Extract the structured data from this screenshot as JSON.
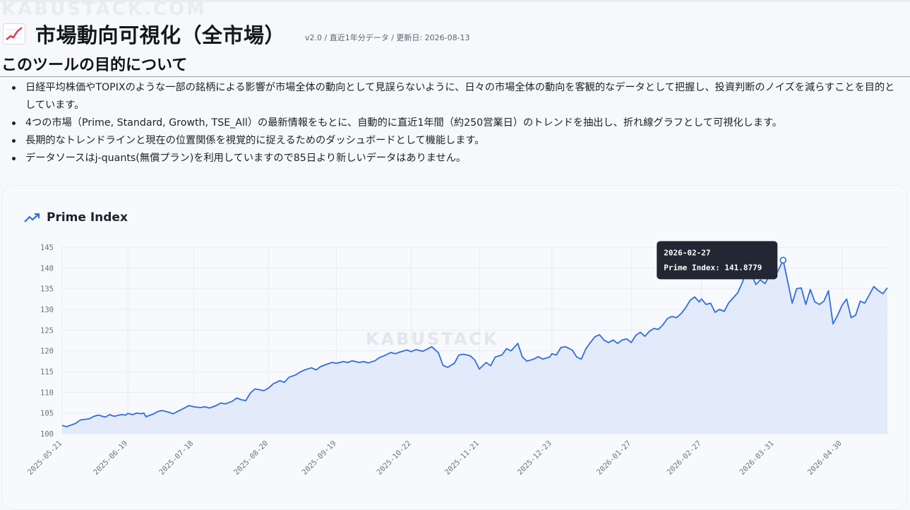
{
  "watermark": "KABUSTACK.COM",
  "header": {
    "icon": "chart-increasing-icon",
    "title": "市場動向可視化（全市場）",
    "meta": "v2.0 / 直近1年分データ / 更新日: 2026-08-13"
  },
  "purpose": {
    "title": "このツールの目的について",
    "items": [
      "日経平均株価やTOPIXのような一部の銘柄による影響が市場全体の動向として見誤らないように、日々の市場全体の動向を客観的なデータとして把握し、投資判断のノイズを減らすことを目的としています。",
      "4つの市場（Prime, Standard, Growth, TSE_All）の最新情報をもとに、自動的に直近1年間（約250営業日）のトレンドを抽出し、折れ線グラフとして可視化します。",
      "長期的なトレンドラインと現在の位置関係を視覚的に捉えるためのダッシュボードとして機能します。",
      "データソースはj-quants(無償プラン)を利用していますので85日より新しいデータはありません。"
    ]
  },
  "colors": {
    "line": "#2f6ee0",
    "area": "#dfe7f8",
    "grid": "#e8ebf0"
  },
  "chart_data": {
    "type": "area",
    "title": "Prime Index",
    "series_name": "Prime Index",
    "watermark": "KABUSTACK",
    "ylim": [
      100,
      145
    ],
    "yticks": [
      100,
      105,
      110,
      115,
      120,
      125,
      130,
      135,
      140,
      145
    ],
    "xlim": [
      "2025-05-21",
      "2026-05-20"
    ],
    "xticks": [
      "2025-05-21",
      "2025-06-19",
      "2025-07-18",
      "2025-08-20",
      "2025-09-19",
      "2025-10-22",
      "2025-11-21",
      "2025-12-23",
      "2026-01-27",
      "2026-02-27",
      "2026-03-31",
      "2026-04-30"
    ],
    "grid": true,
    "tooltip": {
      "date": "2026-02-27",
      "label": "Prime Index: 141.8779",
      "value": 141.8779
    },
    "points": [
      [
        "2025-05-21",
        102.0
      ],
      [
        "2025-05-23",
        101.7
      ],
      [
        "2025-05-27",
        102.5
      ],
      [
        "2025-05-29",
        103.3
      ],
      [
        "2025-06-02",
        103.6
      ],
      [
        "2025-06-04",
        104.2
      ],
      [
        "2025-06-06",
        104.5
      ],
      [
        "2025-06-09",
        104.0
      ],
      [
        "2025-06-11",
        104.6
      ],
      [
        "2025-06-13",
        104.2
      ],
      [
        "2025-06-16",
        104.6
      ],
      [
        "2025-06-18",
        104.5
      ],
      [
        "2025-06-19",
        104.9
      ],
      [
        "2025-06-21",
        104.6
      ],
      [
        "2025-06-23",
        105.0
      ],
      [
        "2025-06-25",
        104.8
      ],
      [
        "2025-06-26",
        105.0
      ],
      [
        "2025-06-27",
        104.1
      ],
      [
        "2025-06-30",
        104.7
      ],
      [
        "2025-07-02",
        105.3
      ],
      [
        "2025-07-04",
        105.6
      ],
      [
        "2025-07-07",
        105.2
      ],
      [
        "2025-07-09",
        104.8
      ],
      [
        "2025-07-11",
        105.4
      ],
      [
        "2025-07-14",
        106.2
      ],
      [
        "2025-07-16",
        106.8
      ],
      [
        "2025-07-18",
        106.5
      ],
      [
        "2025-07-21",
        106.3
      ],
      [
        "2025-07-23",
        106.5
      ],
      [
        "2025-07-25",
        106.2
      ],
      [
        "2025-07-28",
        106.8
      ],
      [
        "2025-07-30",
        107.4
      ],
      [
        "2025-08-01",
        107.2
      ],
      [
        "2025-08-04",
        107.8
      ],
      [
        "2025-08-06",
        108.6
      ],
      [
        "2025-08-08",
        108.2
      ],
      [
        "2025-08-10",
        108.0
      ],
      [
        "2025-08-12",
        109.8
      ],
      [
        "2025-08-14",
        110.8
      ],
      [
        "2025-08-16",
        110.6
      ],
      [
        "2025-08-18",
        110.4
      ],
      [
        "2025-08-20",
        111.0
      ],
      [
        "2025-08-22",
        112.0
      ],
      [
        "2025-08-25",
        112.8
      ],
      [
        "2025-08-27",
        112.4
      ],
      [
        "2025-08-29",
        113.6
      ],
      [
        "2025-09-01",
        114.2
      ],
      [
        "2025-09-03",
        114.9
      ],
      [
        "2025-09-05",
        115.4
      ],
      [
        "2025-09-08",
        115.9
      ],
      [
        "2025-09-10",
        115.4
      ],
      [
        "2025-09-12",
        116.2
      ],
      [
        "2025-09-15",
        116.8
      ],
      [
        "2025-09-17",
        117.2
      ],
      [
        "2025-09-19",
        117.0
      ],
      [
        "2025-09-22",
        117.4
      ],
      [
        "2025-09-24",
        117.2
      ],
      [
        "2025-09-26",
        117.6
      ],
      [
        "2025-09-29",
        117.2
      ],
      [
        "2025-10-01",
        117.4
      ],
      [
        "2025-10-03",
        117.1
      ],
      [
        "2025-10-06",
        117.6
      ],
      [
        "2025-10-08",
        118.4
      ],
      [
        "2025-10-10",
        118.8
      ],
      [
        "2025-10-13",
        119.6
      ],
      [
        "2025-10-15",
        119.3
      ],
      [
        "2025-10-17",
        119.7
      ],
      [
        "2025-10-20",
        120.2
      ],
      [
        "2025-10-22",
        119.8
      ],
      [
        "2025-10-24",
        120.3
      ],
      [
        "2025-10-27",
        119.9
      ],
      [
        "2025-10-29",
        120.4
      ],
      [
        "2025-10-31",
        121.0
      ],
      [
        "2025-11-03",
        119.5
      ],
      [
        "2025-11-05",
        116.5
      ],
      [
        "2025-11-07",
        116.0
      ],
      [
        "2025-11-10",
        117.0
      ],
      [
        "2025-11-12",
        119.0
      ],
      [
        "2025-11-14",
        119.2
      ],
      [
        "2025-11-17",
        118.8
      ],
      [
        "2025-11-19",
        117.8
      ],
      [
        "2025-11-21",
        115.6
      ],
      [
        "2025-11-24",
        117.2
      ],
      [
        "2025-11-26",
        116.4
      ],
      [
        "2025-11-28",
        118.5
      ],
      [
        "2025-12-01",
        119.0
      ],
      [
        "2025-12-03",
        120.5
      ],
      [
        "2025-12-05",
        120.0
      ],
      [
        "2025-12-08",
        121.8
      ],
      [
        "2025-12-10",
        118.5
      ],
      [
        "2025-12-12",
        117.5
      ],
      [
        "2025-12-15",
        118.0
      ],
      [
        "2025-12-17",
        118.6
      ],
      [
        "2025-12-19",
        118.0
      ],
      [
        "2025-12-22",
        118.5
      ],
      [
        "2025-12-23",
        119.3
      ],
      [
        "2025-12-25",
        119.0
      ],
      [
        "2025-12-27",
        120.8
      ],
      [
        "2025-12-29",
        121.0
      ],
      [
        "2026-01-01",
        120.2
      ],
      [
        "2026-01-03",
        118.5
      ],
      [
        "2026-01-05",
        118.0
      ],
      [
        "2026-01-07",
        120.5
      ],
      [
        "2026-01-09",
        122.0
      ],
      [
        "2026-01-11",
        123.4
      ],
      [
        "2026-01-13",
        123.9
      ],
      [
        "2026-01-15",
        122.6
      ],
      [
        "2026-01-17",
        122.0
      ],
      [
        "2026-01-19",
        122.6
      ],
      [
        "2026-01-21",
        121.8
      ],
      [
        "2026-01-23",
        122.6
      ],
      [
        "2026-01-25",
        122.9
      ],
      [
        "2026-01-27",
        122.0
      ],
      [
        "2026-01-29",
        123.7
      ],
      [
        "2026-01-31",
        124.5
      ],
      [
        "2026-02-02",
        123.5
      ],
      [
        "2026-02-04",
        124.7
      ],
      [
        "2026-02-06",
        125.4
      ],
      [
        "2026-02-08",
        125.2
      ],
      [
        "2026-02-10",
        126.3
      ],
      [
        "2026-02-12",
        127.8
      ],
      [
        "2026-02-14",
        128.3
      ],
      [
        "2026-02-16",
        128.0
      ],
      [
        "2026-02-18",
        129.0
      ],
      [
        "2026-02-20",
        130.4
      ],
      [
        "2026-02-22",
        132.2
      ],
      [
        "2026-02-24",
        133.0
      ],
      [
        "2026-02-26",
        131.8
      ],
      [
        "2026-02-27",
        132.5
      ],
      [
        "2026-03-01",
        131.2
      ],
      [
        "2026-03-03",
        131.5
      ],
      [
        "2026-03-05",
        129.3
      ],
      [
        "2026-03-07",
        130.0
      ],
      [
        "2026-03-09",
        129.5
      ],
      [
        "2026-03-11",
        131.6
      ],
      [
        "2026-03-13",
        132.8
      ],
      [
        "2026-03-15",
        134.0
      ],
      [
        "2026-03-17",
        136.5
      ],
      [
        "2026-03-19",
        139.5
      ],
      [
        "2026-03-21",
        138.4
      ],
      [
        "2026-03-23",
        136.0
      ],
      [
        "2026-03-25",
        137.1
      ],
      [
        "2026-03-27",
        136.2
      ],
      [
        "2026-03-29",
        138.2
      ],
      [
        "2026-03-31",
        137.4
      ],
      [
        "2026-04-02",
        139.6
      ],
      [
        "2026-04-04",
        141.8779
      ],
      [
        "2026-04-06",
        136.8
      ],
      [
        "2026-04-08",
        131.5
      ],
      [
        "2026-04-10",
        135.0
      ],
      [
        "2026-04-12",
        135.2
      ],
      [
        "2026-04-14",
        131.2
      ],
      [
        "2026-04-16",
        134.8
      ],
      [
        "2026-04-18",
        131.8
      ],
      [
        "2026-04-20",
        131.2
      ],
      [
        "2026-04-22",
        132.0
      ],
      [
        "2026-04-24",
        134.5
      ],
      [
        "2026-04-26",
        126.5
      ],
      [
        "2026-04-28",
        128.5
      ],
      [
        "2026-04-30",
        131.0
      ],
      [
        "2026-05-02",
        132.5
      ],
      [
        "2026-05-04",
        128.0
      ],
      [
        "2026-05-06",
        128.6
      ],
      [
        "2026-05-08",
        132.0
      ],
      [
        "2026-05-10",
        131.5
      ],
      [
        "2026-05-12",
        133.5
      ],
      [
        "2026-05-14",
        135.5
      ],
      [
        "2026-05-16",
        134.5
      ],
      [
        "2026-05-18",
        133.8
      ],
      [
        "2026-05-20",
        135.2
      ]
    ]
  }
}
